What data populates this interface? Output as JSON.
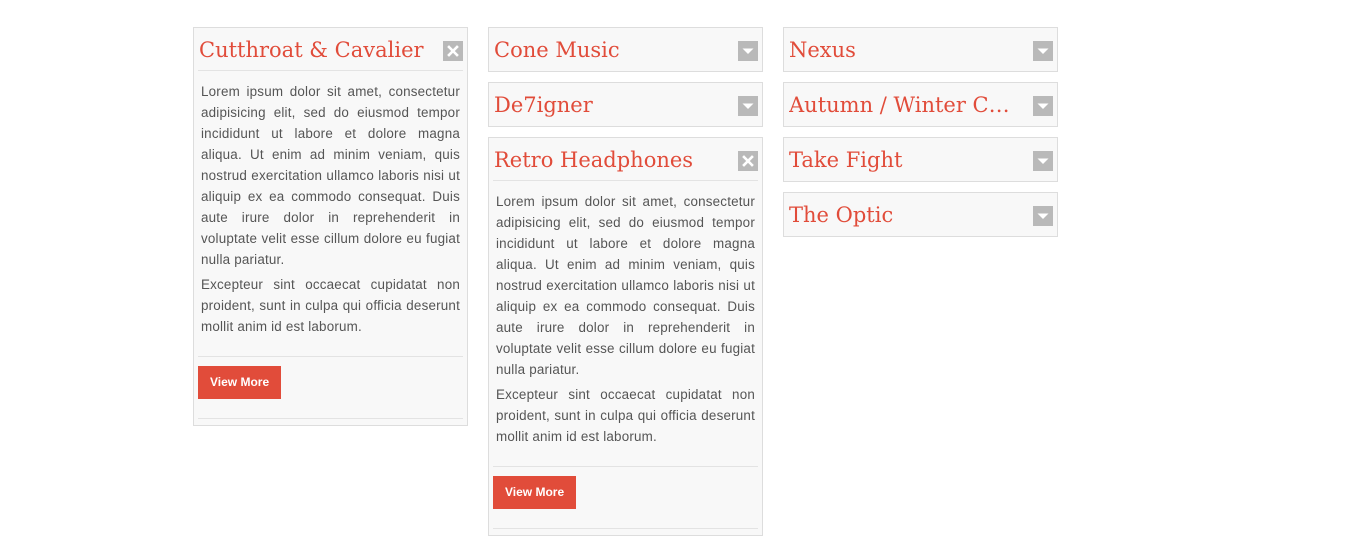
{
  "columns": [
    {
      "panels": [
        {
          "title": "Cutthroat & Cavalier",
          "state": "expanded",
          "toggle_icon": "close-icon",
          "paragraphs": [
            "Lorem ipsum dolor sit amet, consectetur adipisicing elit, sed do eiusmod tempor incididunt ut labore et dolore magna aliqua. Ut enim ad minim veniam, quis nostrud exercitation ullamco laboris nisi ut aliquip ex ea commodo consequat. Duis aute irure dolor in reprehenderit in voluptate velit esse cillum dolore eu fugiat nulla pariatur.",
            "Excepteur sint occaecat cupidatat non proident, sunt in culpa qui officia deserunt mollit anim id est laborum."
          ],
          "button_label": "View More"
        }
      ]
    },
    {
      "panels": [
        {
          "title": "Cone Music",
          "state": "collapsed",
          "toggle_icon": "chevron-down-icon"
        },
        {
          "title": "De7igner",
          "state": "collapsed",
          "toggle_icon": "chevron-down-icon"
        },
        {
          "title": "Retro Headphones",
          "state": "expanded",
          "toggle_icon": "close-icon",
          "paragraphs": [
            "Lorem ipsum dolor sit amet, consectetur adipisicing elit, sed do eiusmod tempor incididunt ut labore et dolore magna aliqua. Ut enim ad minim veniam, quis nostrud exercitation ullamco laboris nisi ut aliquip ex ea commodo consequat. Duis aute irure dolor in reprehenderit in voluptate velit esse cillum dolore eu fugiat nulla pariatur.",
            "Excepteur sint occaecat cupidatat non proident, sunt in culpa qui officia deserunt mollit anim id est laborum."
          ],
          "button_label": "View More"
        }
      ]
    },
    {
      "panels": [
        {
          "title": "Nexus",
          "state": "collapsed",
          "toggle_icon": "chevron-down-icon"
        },
        {
          "title": "Autumn / Winter Collection",
          "state": "collapsed",
          "toggle_icon": "chevron-down-icon"
        },
        {
          "title": "Take Fight",
          "state": "collapsed",
          "toggle_icon": "chevron-down-icon"
        },
        {
          "title": "The Optic",
          "state": "collapsed",
          "toggle_icon": "chevron-down-icon"
        }
      ]
    }
  ],
  "colors": {
    "accent": "#e14c3a",
    "panel_bg": "#f8f8f8",
    "panel_border": "#dddddd",
    "toggle_bg": "#b9b9b9",
    "body_text": "#555555"
  }
}
